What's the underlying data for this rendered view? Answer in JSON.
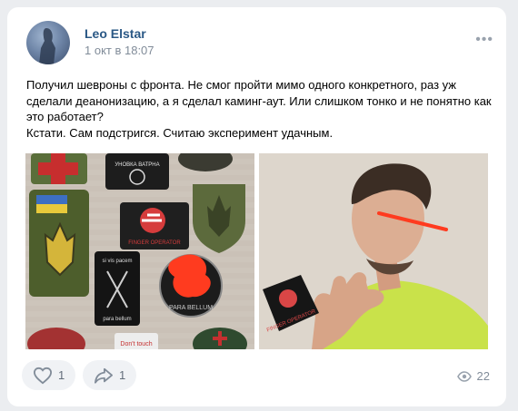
{
  "post": {
    "author": "Leo Elstar",
    "time": "1 окт в 18:07",
    "text_lines": [
      "Получил шевроны с фронта. Не смог пройти мимо одного конкретного, раз уж сделали деанонизацию, а я сделал каминг-аут. Или слишком тонко и не понятно как это работает?",
      "Кстати. Сам подстригся. Считаю эксперимент удачным."
    ],
    "patch_texts": {
      "patch_a": "УНОВКА ВАТРНА",
      "patch_b": "FINGER OPERATOR",
      "patch_c": "si vis pacem",
      "patch_d": "para bellum",
      "patch_e": "PARA BELLUM",
      "patch_f": "Don't touch",
      "patch_g": "FINGER OPERATOR"
    }
  },
  "actions": {
    "likes": "1",
    "shares": "1",
    "views": "22"
  },
  "icons": {
    "more": "more-icon",
    "like": "heart-icon",
    "share": "share-icon",
    "views": "eye-icon"
  }
}
